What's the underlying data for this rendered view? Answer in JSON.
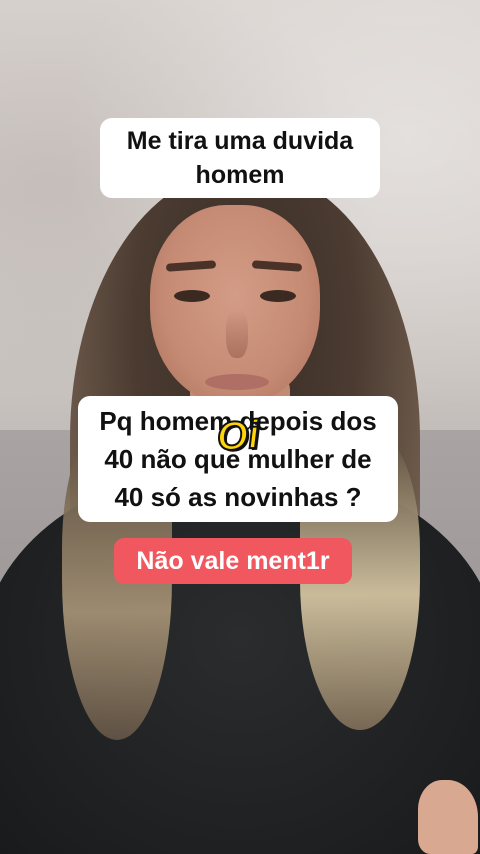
{
  "captions": {
    "top_line1": "Me tira uma duvida",
    "top_line2": "homem",
    "mid_line1": "Pq homem depois dos",
    "mid_line2": "40 não que mulher de",
    "mid_line3": "40 só as novinhas ?",
    "red": "Não vale ment1r"
  },
  "sticker": {
    "text": "Oi",
    "color": "#ffd40a"
  },
  "colors": {
    "caption_bg": "#ffffff",
    "red_caption_bg": "#f0575e"
  }
}
